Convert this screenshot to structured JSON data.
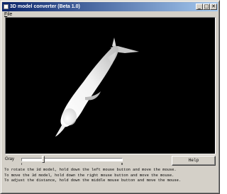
{
  "window": {
    "title": "3D model converter (Beta 1.0)",
    "accent": "#0a246a"
  },
  "titlebar": {
    "minimize_glyph": "_",
    "maximize_glyph": "□",
    "close_glyph": "✕"
  },
  "menu": {
    "items": [
      {
        "label": "File",
        "underline": "F",
        "rest": "ile"
      }
    ]
  },
  "viewport": {
    "background": "#000000",
    "model": "dolphin"
  },
  "gray_control": {
    "label": "Gray",
    "value_fraction": 0.21
  },
  "help_button": {
    "label": "Help"
  },
  "instructions": [
    "To rotate the 3d model, hold down the left mouse button and move the mouse.",
    "To move the 3d model, hold down the right mouse button and move the mouse.",
    "To adjust the distance, hold down the middle mouse button and move the mouse."
  ]
}
